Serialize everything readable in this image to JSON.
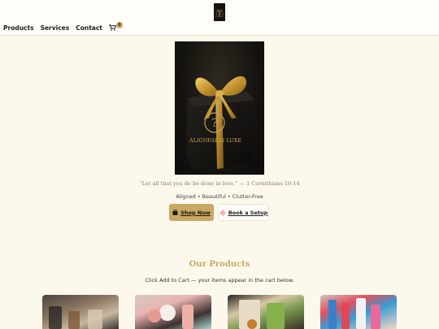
{
  "header": {
    "logo_icon": "gift-box-logo-icon",
    "nav": [
      {
        "label": "Products"
      },
      {
        "label": "Services"
      },
      {
        "label": "Contact"
      }
    ],
    "cart": {
      "icon": "cart-icon",
      "count": "0"
    }
  },
  "hero": {
    "image": "black gift box with gold ribbon",
    "box_text": "ALIGNFARAI LUXE",
    "quote": "“Let all that you do be done in love.” — 1 Corinthians 16:14",
    "tagline": "Aligned • Beautiful • Clutter-Free",
    "shop_button": {
      "icon": "shopping-bag-icon",
      "label": "Shop Now"
    },
    "book_button": {
      "icon": "flower-icon",
      "label": "Book a Setup"
    }
  },
  "products": {
    "title": "Our Products",
    "subtitle": "Click Add to Cart — your items appear in the cart below.",
    "items": [
      {
        "image": "coffee station organizer"
      },
      {
        "image": "beauty products tray"
      },
      {
        "image": "snack pantry organizer"
      },
      {
        "image": "travel toiletry kit"
      }
    ]
  },
  "colors": {
    "background": "#fdf8ec",
    "accent_gold": "#c9a866",
    "header": "#fffdf8"
  }
}
